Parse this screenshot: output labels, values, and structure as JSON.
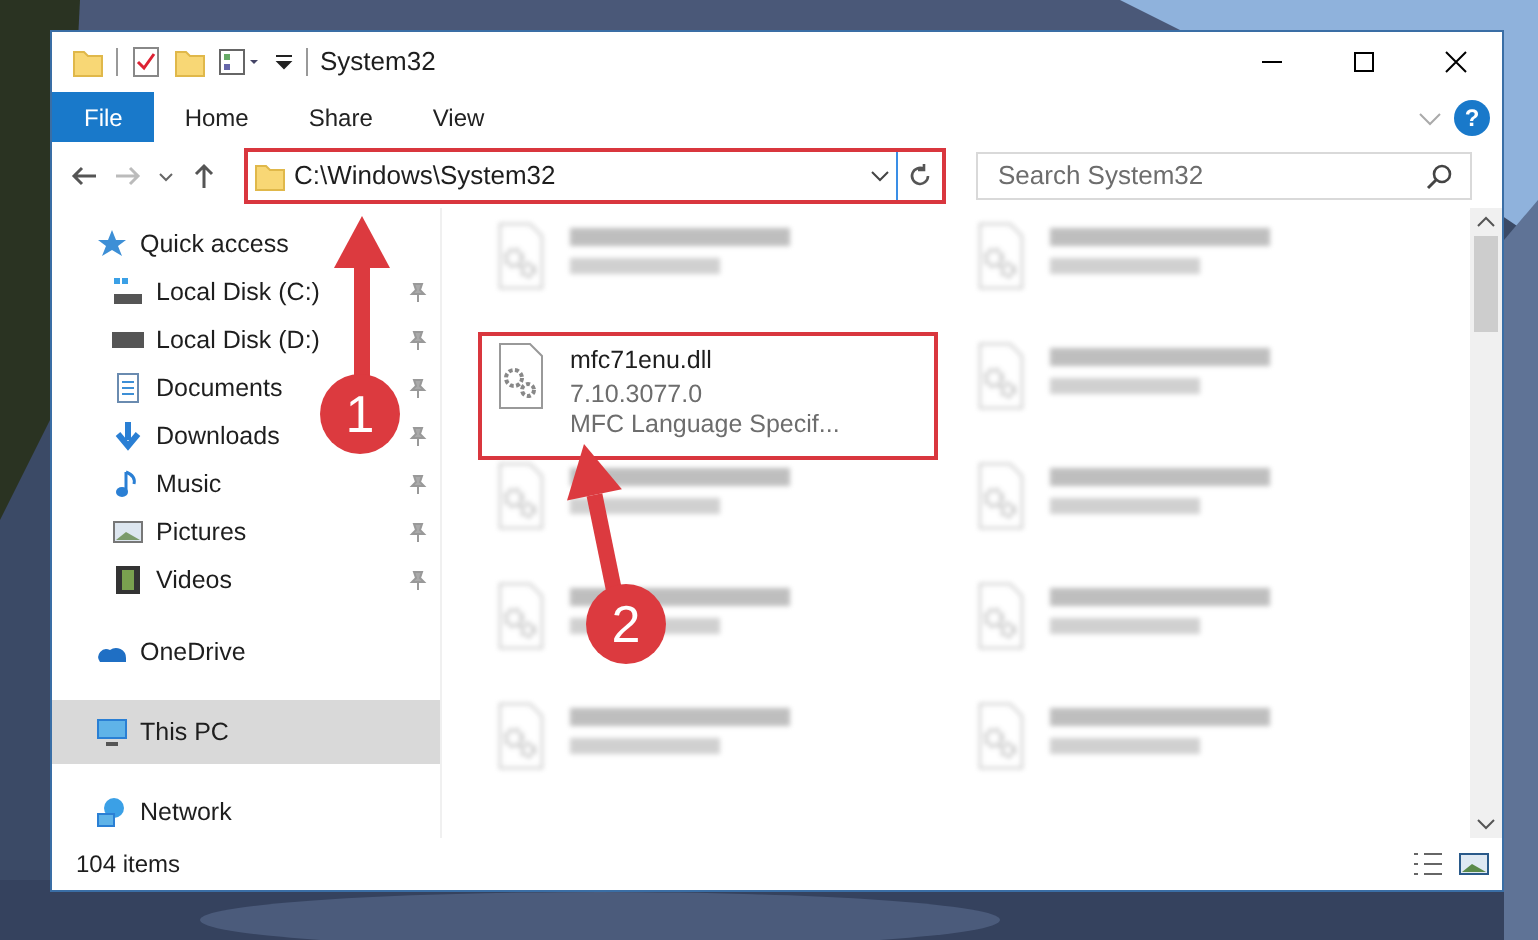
{
  "window": {
    "title": "System32",
    "help": "?"
  },
  "ribbon_tabs": [
    {
      "label": "File",
      "selected": true
    },
    {
      "label": "Home",
      "selected": false
    },
    {
      "label": "Share",
      "selected": false
    },
    {
      "label": "View",
      "selected": false
    }
  ],
  "address": {
    "path": "C:\\Windows\\System32"
  },
  "search": {
    "placeholder": "Search System32"
  },
  "sidebar": {
    "items": [
      {
        "label": "Quick access",
        "kind": "star",
        "pinned": false,
        "selected": false,
        "group": true
      },
      {
        "label": "Local Disk (C:)",
        "kind": "disk-win",
        "pinned": true,
        "selected": false,
        "group": false
      },
      {
        "label": "Local Disk (D:)",
        "kind": "disk",
        "pinned": true,
        "selected": false,
        "group": false
      },
      {
        "label": "Documents",
        "kind": "doc",
        "pinned": true,
        "selected": false,
        "group": false
      },
      {
        "label": "Downloads",
        "kind": "down",
        "pinned": true,
        "selected": false,
        "group": false
      },
      {
        "label": "Music",
        "kind": "music",
        "pinned": true,
        "selected": false,
        "group": false
      },
      {
        "label": "Pictures",
        "kind": "pic",
        "pinned": true,
        "selected": false,
        "group": false
      },
      {
        "label": "Videos",
        "kind": "video",
        "pinned": true,
        "selected": false,
        "group": false
      },
      {
        "label": "OneDrive",
        "kind": "cloud",
        "pinned": false,
        "selected": false,
        "group": true
      },
      {
        "label": "This PC",
        "kind": "pc",
        "pinned": false,
        "selected": true,
        "group": true
      },
      {
        "label": "Network",
        "kind": "net",
        "pinned": false,
        "selected": false,
        "group": true
      }
    ]
  },
  "files": [
    {
      "kind": "blurred"
    },
    {
      "kind": "blurred"
    },
    {
      "kind": "file",
      "name": "mfc71enu.dll",
      "lines": [
        "7.10.3077.0",
        "MFC Language Specif..."
      ],
      "highlighted": true
    },
    {
      "kind": "blurred"
    },
    {
      "kind": "blurred"
    },
    {
      "kind": "blurred"
    },
    {
      "kind": "blurred"
    },
    {
      "kind": "blurred"
    },
    {
      "kind": "blurred"
    },
    {
      "kind": "blurred"
    }
  ],
  "status_bar": {
    "count": "104 items"
  },
  "annotations": [
    {
      "label": "1"
    },
    {
      "label": "2"
    }
  ]
}
